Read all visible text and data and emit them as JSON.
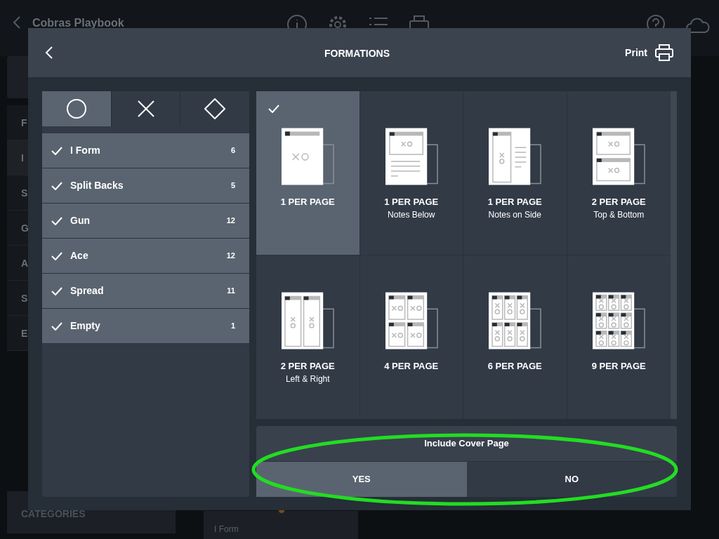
{
  "app_bar": {
    "title": "Cobras Playbook"
  },
  "background_sidebar": {
    "items": [
      "F",
      "I",
      "S",
      "G",
      "A",
      "S",
      "E"
    ],
    "footer": "CATEGORIES"
  },
  "background_card": {
    "label": "I Form"
  },
  "dialog": {
    "title": "FORMATIONS",
    "print_label": "Print"
  },
  "shape_tabs": [
    {
      "kind": "circle",
      "selected": true
    },
    {
      "kind": "cross",
      "selected": false
    },
    {
      "kind": "diamond",
      "selected": false
    }
  ],
  "formations": [
    {
      "name": "I Form",
      "count": "6",
      "checked": true
    },
    {
      "name": "Split Backs",
      "count": "5",
      "checked": true
    },
    {
      "name": "Gun",
      "count": "12",
      "checked": true
    },
    {
      "name": "Ace",
      "count": "12",
      "checked": true
    },
    {
      "name": "Spread",
      "count": "11",
      "checked": true
    },
    {
      "name": "Empty",
      "count": "1",
      "checked": true
    }
  ],
  "layouts": [
    {
      "kind": "single",
      "title": "1 PER PAGE",
      "selected": true
    },
    {
      "kind": "notes_below",
      "title": "1 PER PAGE",
      "subtitle": "Notes Below",
      "selected": false
    },
    {
      "kind": "notes_side",
      "title": "1 PER PAGE",
      "subtitle": "Notes on Side",
      "selected": false
    },
    {
      "kind": "top_bottom",
      "title": "2 PER PAGE",
      "subtitle": "Top & Bottom",
      "selected": false
    },
    {
      "kind": "left_right",
      "title": "2 PER PAGE",
      "subtitle": "Left & Right",
      "selected": false
    },
    {
      "kind": "grid4",
      "title": "4 PER PAGE",
      "selected": false
    },
    {
      "kind": "grid6",
      "title": "6 PER PAGE",
      "selected": false
    },
    {
      "kind": "grid9",
      "title": "9 PER PAGE",
      "selected": false
    }
  ],
  "cover_page": {
    "label": "Include Cover Page",
    "options": [
      {
        "label": "YES",
        "selected": true
      },
      {
        "label": "NO",
        "selected": false
      }
    ]
  }
}
